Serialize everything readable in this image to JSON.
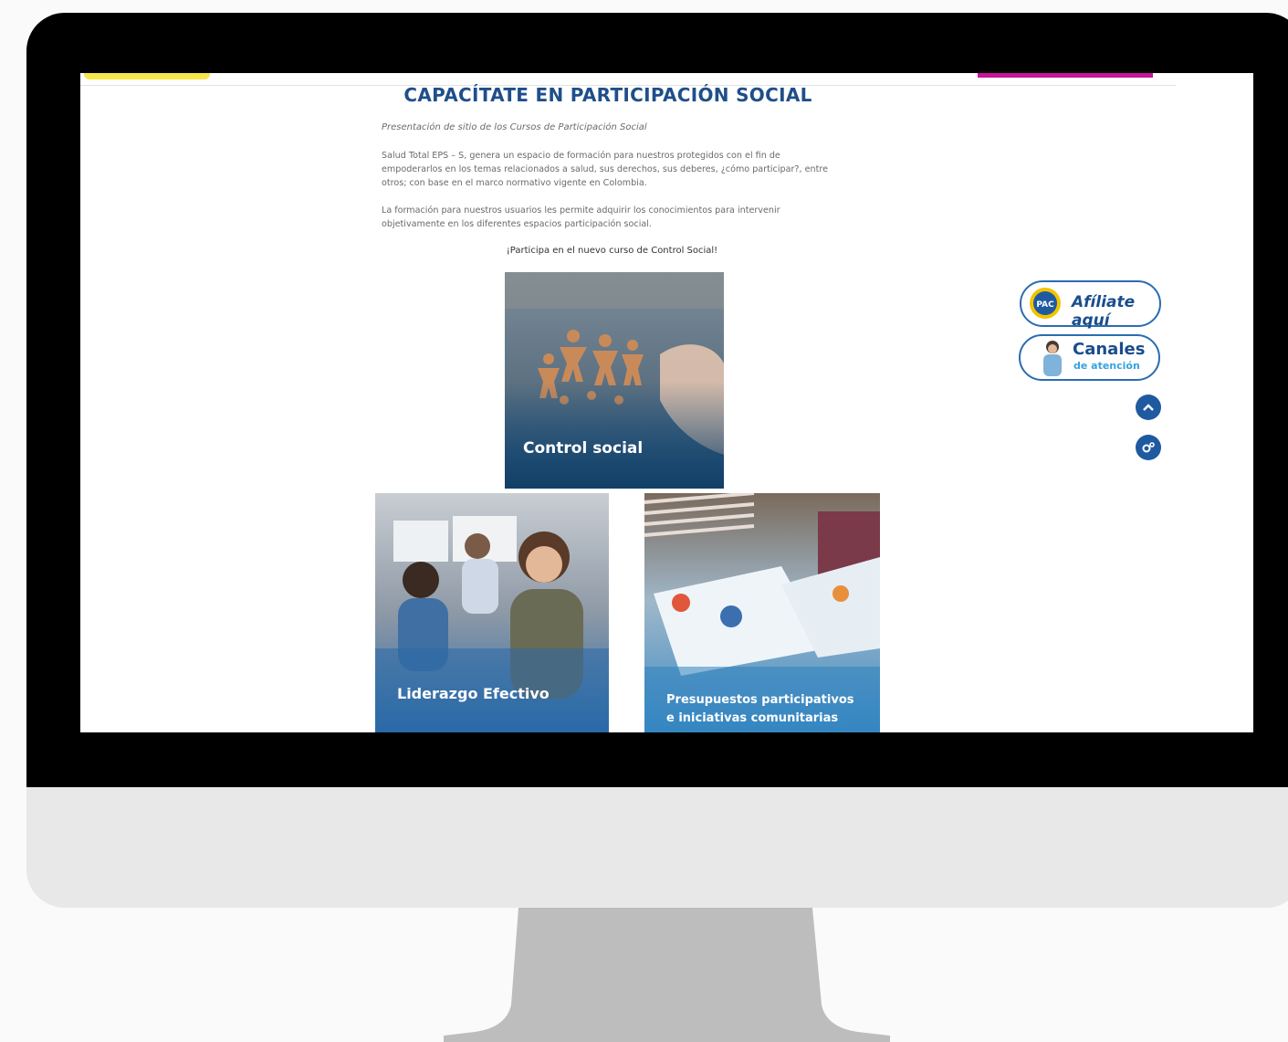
{
  "page": {
    "title": "CAPACÍTATE EN PARTICIPACIÓN SOCIAL",
    "subtitle": "Presentación de sitio de los Cursos de Participación Social",
    "paragraph1": "Salud Total EPS – S, genera un espacio de formación para nuestros protegidos con el fin de empoderarlos en los temas relacionados a salud, sus derechos, sus deberes, ¿cómo participar?, entre otros; con base en el marco normativo vigente en Colombia.",
    "paragraph2": "La formación para nuestros usuarios les permite adquirir los conocimientos para intervenir objetivamente en los diferentes espacios participación social.",
    "cta": "¡Participa en el nuevo curso de Control Social!"
  },
  "courses": [
    {
      "label": "Control social"
    },
    {
      "label": "Liderazgo Efectivo"
    },
    {
      "label_line1": "Presupuestos participativos",
      "label_line2": "e iniciativas comunitarias"
    }
  ],
  "sidebar": {
    "afiliate_logo": "PAC",
    "afiliate_label": "Afíliate aquí",
    "canales_label": "Canales",
    "canales_sub": "de atención"
  },
  "colors": {
    "title": "#1f4f8a",
    "accent_blue": "#1f5aa0",
    "highlight_yellow": "#f5e64a",
    "highlight_magenta": "#c8149b"
  }
}
